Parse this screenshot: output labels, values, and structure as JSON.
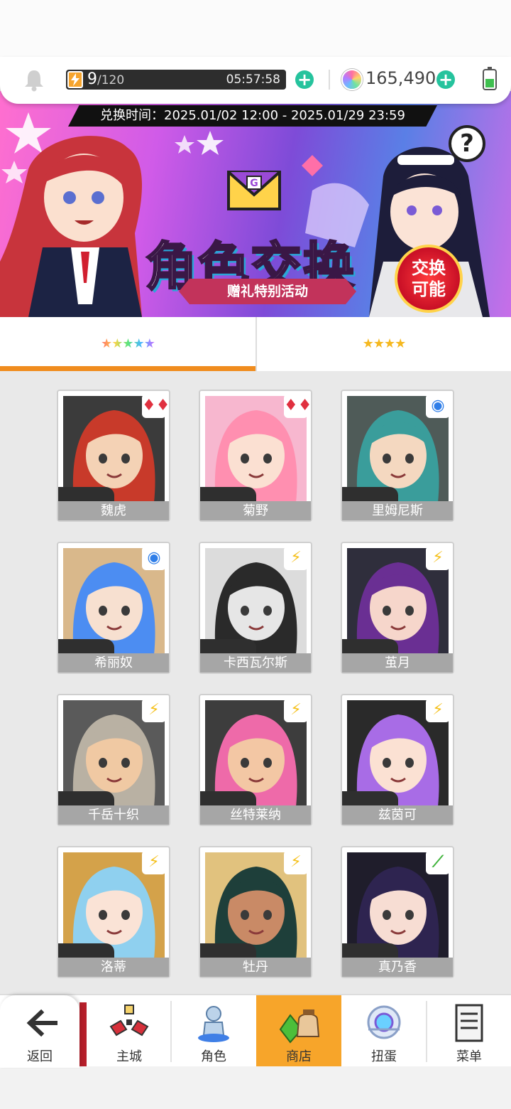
{
  "topbar": {
    "stamina_current": "9",
    "stamina_max": "/120",
    "stamina_timer": "05:57:58",
    "gems": "165,490"
  },
  "banner": {
    "date_range": "兑换时间：2025.01/02 12:00 - 2025.01/29 23:59",
    "title": "角色交换",
    "subtitle": "赠礼特别活动",
    "badge_line1": "交换",
    "badge_line2": "可能",
    "help": "?"
  },
  "tabs": [
    {
      "stars": "★★★★★"
    },
    {
      "stars": "★★★★"
    }
  ],
  "characters": [
    {
      "name": "魏虎",
      "attr": "♦♦",
      "attr_color": "#e0303f",
      "stars": "★★★★★",
      "hair": "#c83a2a",
      "skin": "#f4d2b5",
      "bg": "#3b3b3b"
    },
    {
      "name": "菊野",
      "attr": "♦♦",
      "attr_color": "#e0303f",
      "stars": "★★★★★",
      "hair": "#ff8fb0",
      "skin": "#fbe0d2",
      "bg": "#f7b7cf"
    },
    {
      "name": "里姆尼斯",
      "attr": "◉",
      "attr_color": "#2f7ee8",
      "stars": "★★★★★",
      "hair": "#3a9d9b",
      "skin": "#f4d8c0",
      "bg": "#4f5b58"
    },
    {
      "name": "希丽奴",
      "attr": "◉",
      "attr_color": "#2f7ee8",
      "stars": "★★★★★",
      "hair": "#4c8df2",
      "skin": "#f7e0d0",
      "bg": "#d9b88b"
    },
    {
      "name": "卡西瓦尔斯",
      "attr": "⚡",
      "attr_color": "#f5c11e",
      "stars": "★★★★★",
      "hair": "#2a2a2a",
      "skin": "#e6e6e6",
      "bg": "#dcdcdc"
    },
    {
      "name": "茧月",
      "attr": "⚡",
      "attr_color": "#f5c11e",
      "stars": "★★★★★",
      "hair": "#6a2f93",
      "skin": "#f6d6cb",
      "bg": "#2f2e3c"
    },
    {
      "name": "千岳十织",
      "attr": "⚡",
      "attr_color": "#f5c11e",
      "stars": "★★★★★",
      "hair": "#b9b1a3",
      "skin": "#f0c9a3",
      "bg": "#5a5a5a"
    },
    {
      "name": "丝特莱纳",
      "attr": "⚡",
      "attr_color": "#f5c11e",
      "stars": "★★★★★",
      "hair": "#ee6aa9",
      "skin": "#f3c7a4",
      "bg": "#3d3d3d"
    },
    {
      "name": "兹茵可",
      "attr": "⚡",
      "attr_color": "#f5c11e",
      "stars": "★★★★★",
      "hair": "#a86ce6",
      "skin": "#fbe1d3",
      "bg": "#2a2a2a"
    },
    {
      "name": "洛蒂",
      "attr": "⚡",
      "attr_color": "#f5c11e",
      "stars": "★★★★★",
      "hair": "#8fd0ef",
      "skin": "#fae3d6",
      "bg": "#d4a24a"
    },
    {
      "name": "牡丹",
      "attr": "⚡",
      "attr_color": "#f5c11e",
      "stars": "★★★★★",
      "hair": "#1e3f3a",
      "skin": "#c98a66",
      "bg": "#e1c27e"
    },
    {
      "name": "真乃香",
      "attr": "⟋",
      "attr_color": "#3fb33a",
      "stars": "★★★★★",
      "hair": "#2e2450",
      "skin": "#f7ddd3",
      "bg": "#1f1d2b"
    }
  ],
  "nav": [
    {
      "label": "返回",
      "icon": "back-arrow-icon"
    },
    {
      "label": "主城",
      "icon": "main-city-icon"
    },
    {
      "label": "角色",
      "icon": "character-icon"
    },
    {
      "label": "商店",
      "icon": "shop-icon"
    },
    {
      "label": "扭蛋",
      "icon": "gacha-icon"
    },
    {
      "label": "菜单",
      "icon": "menu-icon"
    }
  ],
  "colors": {
    "accent": "#f08c1e",
    "nav_active": "#f7a52a",
    "plus": "#25c39d"
  }
}
